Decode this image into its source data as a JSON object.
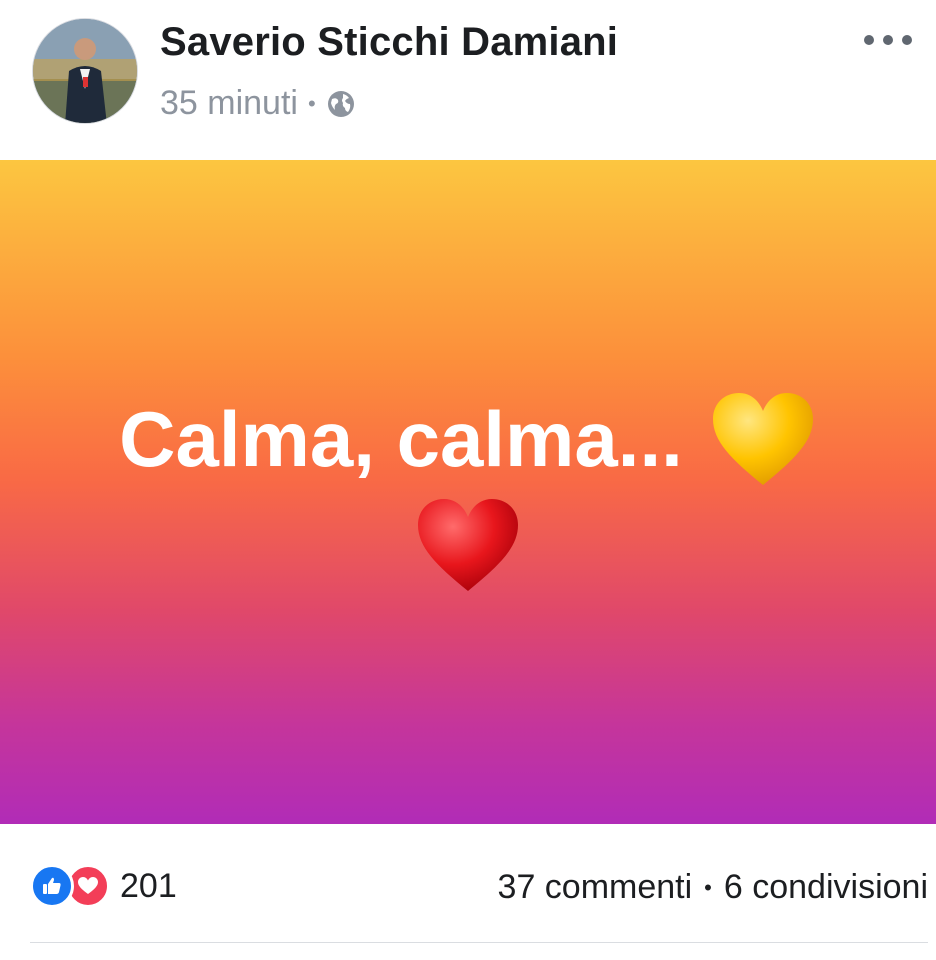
{
  "post": {
    "author": "Saverio Sticchi Damiani",
    "time": "35 minuti",
    "privacy_icon": "globe-icon",
    "more_icon": "more-horizontal-icon"
  },
  "status": {
    "line1": "Calma, calma...",
    "emoji1": "yellow-heart",
    "emoji2": "red-heart",
    "gradient": [
      "#fcc640",
      "#fc8f3b",
      "#f96a45",
      "#e0486a",
      "#b12cb7"
    ]
  },
  "footer": {
    "reactions": [
      "like",
      "love"
    ],
    "reaction_count": "201",
    "comments": "37 commenti",
    "shares": "6 condivisioni"
  },
  "colors": {
    "like": "#1877f2",
    "love": "#f33e58",
    "meta_text": "#8d949e"
  }
}
